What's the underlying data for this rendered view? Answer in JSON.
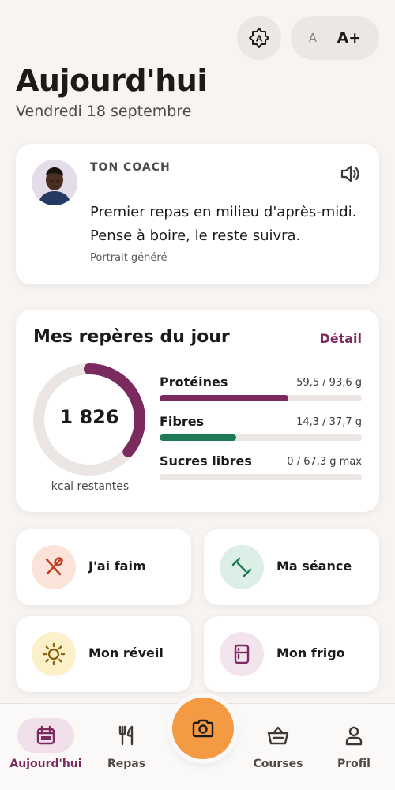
{
  "header": {
    "title": "Aujourd'hui",
    "date": "Vendredi 18 septembre",
    "font_small_label": "A",
    "font_large_label": "A+"
  },
  "coach": {
    "label": "TON COACH",
    "message": "Premier repas en milieu d'après-midi. Pense à boire, le reste suivra.",
    "note": "Portrait généré"
  },
  "reperes": {
    "title": "Mes repères du jour",
    "detail_label": "Détail",
    "kcal_value": "1 826",
    "kcal_label": "kcal restantes",
    "kcal_ring_fraction": 0.36,
    "nutrients": [
      {
        "name": "Protéines",
        "amount": "59,5 / 93,6 g",
        "fraction": 0.636,
        "color": "#7a2a5e"
      },
      {
        "name": "Fibres",
        "amount": "14,3 / 37,7 g",
        "fraction": 0.379,
        "color": "#1e7a55"
      },
      {
        "name": "Sucres libres",
        "amount": "0 / 67,3 g max",
        "fraction": 0,
        "color": "#c24b4b"
      }
    ]
  },
  "tiles": [
    {
      "label": "J'ai faim",
      "icon": "utensils-icon",
      "bg": "#fbe3d9"
    },
    {
      "label": "Ma séance",
      "icon": "dumbbell-icon",
      "bg": "#dcefe6"
    },
    {
      "label": "Mon réveil",
      "icon": "sun-icon",
      "bg": "#fbf0c8"
    },
    {
      "label": "Mon frigo",
      "icon": "fridge-icon",
      "bg": "#f3e3ec"
    }
  ],
  "nav": [
    {
      "label": "Aujourd'hui",
      "icon": "calendar-icon",
      "active": true
    },
    {
      "label": "Repas",
      "icon": "fork-knife-icon",
      "active": false
    },
    {
      "label": "Courses",
      "icon": "basket-icon",
      "active": false
    },
    {
      "label": "Profil",
      "icon": "user-icon",
      "active": false
    }
  ],
  "colors": {
    "accent": "#7a2a5e",
    "green": "#1e7a55",
    "camera": "#f39a43",
    "background": "#f7f4f2"
  }
}
